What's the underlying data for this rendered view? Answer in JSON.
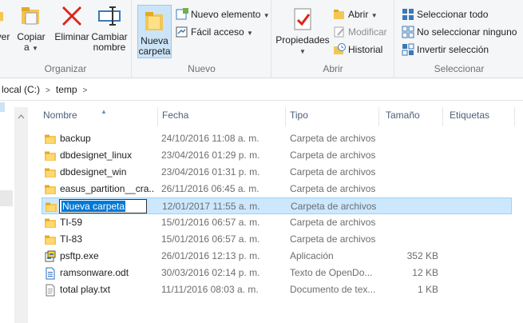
{
  "ribbon": {
    "organize": {
      "label": "Organizar",
      "move_label": "ver",
      "copy_label": "Copiar",
      "copy_sub": "a",
      "delete_label": "Eliminar",
      "rename_label_1": "Cambiar",
      "rename_label_2": "nombre"
    },
    "new": {
      "label": "Nuevo",
      "new_folder_1": "Nueva",
      "new_folder_2": "carpeta",
      "new_item": "Nuevo elemento",
      "easy_access": "Fácil acceso"
    },
    "open": {
      "label": "Abrir",
      "properties": "Propiedades",
      "open": "Abrir",
      "edit": "Modificar",
      "history": "Historial"
    },
    "select": {
      "label": "Seleccionar",
      "select_all": "Seleccionar todo",
      "select_none": "No seleccionar ninguno",
      "invert": "Invertir selección"
    }
  },
  "address": {
    "crumb_1": "local (C:)",
    "crumb_2": "temp"
  },
  "columns": {
    "name": "Nombre",
    "date": "Fecha",
    "type": "Tipo",
    "size": "Tamaño",
    "tags": "Etiquetas"
  },
  "files": [
    {
      "name": "backup",
      "date": "24/10/2016 11:08 a. m.",
      "type": "Carpeta de archivos",
      "size": "",
      "icon": "folder-icon"
    },
    {
      "name": "dbdesignet_linux",
      "date": "23/04/2016 01:29 p. m.",
      "type": "Carpeta de archivos",
      "size": "",
      "icon": "folder-icon"
    },
    {
      "name": "dbdesignet_win",
      "date": "23/04/2016 01:31 p. m.",
      "type": "Carpeta de archivos",
      "size": "",
      "icon": "folder-icon"
    },
    {
      "name": "easus_partition__cra...",
      "date": "26/11/2016 06:45 a. m.",
      "type": "Carpeta de archivos",
      "size": "",
      "icon": "folder-icon"
    },
    {
      "name": "Nueva carpeta",
      "date": "12/01/2017 11:55 a. m.",
      "type": "Carpeta de archivos",
      "size": "",
      "icon": "folder-icon"
    },
    {
      "name": "TI-59",
      "date": "15/01/2016 06:57 a. m.",
      "type": "Carpeta de archivos",
      "size": "",
      "icon": "folder-icon"
    },
    {
      "name": "TI-83",
      "date": "15/01/2016 06:57 a. m.",
      "type": "Carpeta de archivos",
      "size": "",
      "icon": "folder-icon"
    },
    {
      "name": "psftp.exe",
      "date": "26/01/2016 12:13 p. m.",
      "type": "Aplicación",
      "size": "352 KB",
      "icon": "exe-icon"
    },
    {
      "name": "ramsonware.odt",
      "date": "30/03/2016 02:14 p. m.",
      "type": "Texto de OpenDo...",
      "size": "12 KB",
      "icon": "document-icon"
    },
    {
      "name": "total play.txt",
      "date": "11/11/2016 08:03 a. m.",
      "type": "Documento de tex...",
      "size": "1 KB",
      "icon": "text-file-icon"
    }
  ]
}
